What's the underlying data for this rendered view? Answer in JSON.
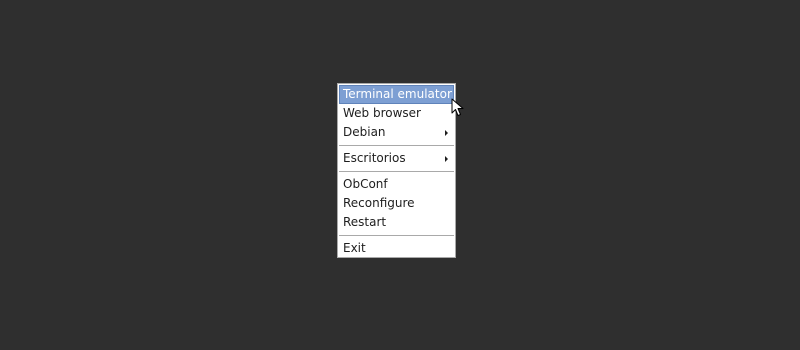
{
  "menu": {
    "items": [
      {
        "label": "Terminal emulator",
        "selected": true,
        "submenu": false
      },
      {
        "label": "Web browser",
        "selected": false,
        "submenu": false
      },
      {
        "label": "Debian",
        "selected": false,
        "submenu": true
      },
      {
        "label": "Escritorios",
        "selected": false,
        "submenu": true
      },
      {
        "label": "ObConf",
        "selected": false,
        "submenu": false
      },
      {
        "label": "Reconfigure",
        "selected": false,
        "submenu": false
      },
      {
        "label": "Restart",
        "selected": false,
        "submenu": false
      },
      {
        "label": "Exit",
        "selected": false,
        "submenu": false
      }
    ]
  },
  "colors": {
    "desktop_background": "#2f2f2f",
    "menu_background": "#ffffff",
    "selection": "#7d9fd3",
    "text": "#1e1e1e"
  },
  "icons": {
    "submenu": "triangle-right",
    "pointer": "arrow-pointer"
  }
}
